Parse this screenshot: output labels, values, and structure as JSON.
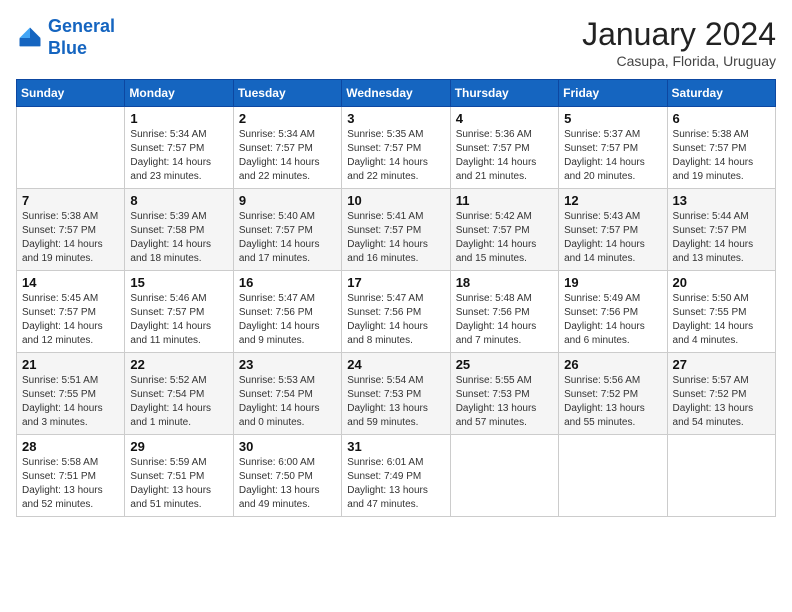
{
  "header": {
    "logo_line1": "General",
    "logo_line2": "Blue",
    "month": "January 2024",
    "location": "Casupa, Florida, Uruguay"
  },
  "days_of_week": [
    "Sunday",
    "Monday",
    "Tuesday",
    "Wednesday",
    "Thursday",
    "Friday",
    "Saturday"
  ],
  "weeks": [
    [
      {
        "day": "",
        "sunrise": "",
        "sunset": "",
        "daylight": ""
      },
      {
        "day": "1",
        "sunrise": "5:34 AM",
        "sunset": "7:57 PM",
        "daylight": "14 hours and 23 minutes."
      },
      {
        "day": "2",
        "sunrise": "5:34 AM",
        "sunset": "7:57 PM",
        "daylight": "14 hours and 22 minutes."
      },
      {
        "day": "3",
        "sunrise": "5:35 AM",
        "sunset": "7:57 PM",
        "daylight": "14 hours and 22 minutes."
      },
      {
        "day": "4",
        "sunrise": "5:36 AM",
        "sunset": "7:57 PM",
        "daylight": "14 hours and 21 minutes."
      },
      {
        "day": "5",
        "sunrise": "5:37 AM",
        "sunset": "7:57 PM",
        "daylight": "14 hours and 20 minutes."
      },
      {
        "day": "6",
        "sunrise": "5:38 AM",
        "sunset": "7:57 PM",
        "daylight": "14 hours and 19 minutes."
      }
    ],
    [
      {
        "day": "7",
        "sunrise": "5:38 AM",
        "sunset": "7:57 PM",
        "daylight": "14 hours and 19 minutes."
      },
      {
        "day": "8",
        "sunrise": "5:39 AM",
        "sunset": "7:58 PM",
        "daylight": "14 hours and 18 minutes."
      },
      {
        "day": "9",
        "sunrise": "5:40 AM",
        "sunset": "7:57 PM",
        "daylight": "14 hours and 17 minutes."
      },
      {
        "day": "10",
        "sunrise": "5:41 AM",
        "sunset": "7:57 PM",
        "daylight": "14 hours and 16 minutes."
      },
      {
        "day": "11",
        "sunrise": "5:42 AM",
        "sunset": "7:57 PM",
        "daylight": "14 hours and 15 minutes."
      },
      {
        "day": "12",
        "sunrise": "5:43 AM",
        "sunset": "7:57 PM",
        "daylight": "14 hours and 14 minutes."
      },
      {
        "day": "13",
        "sunrise": "5:44 AM",
        "sunset": "7:57 PM",
        "daylight": "14 hours and 13 minutes."
      }
    ],
    [
      {
        "day": "14",
        "sunrise": "5:45 AM",
        "sunset": "7:57 PM",
        "daylight": "14 hours and 12 minutes."
      },
      {
        "day": "15",
        "sunrise": "5:46 AM",
        "sunset": "7:57 PM",
        "daylight": "14 hours and 11 minutes."
      },
      {
        "day": "16",
        "sunrise": "5:47 AM",
        "sunset": "7:56 PM",
        "daylight": "14 hours and 9 minutes."
      },
      {
        "day": "17",
        "sunrise": "5:47 AM",
        "sunset": "7:56 PM",
        "daylight": "14 hours and 8 minutes."
      },
      {
        "day": "18",
        "sunrise": "5:48 AM",
        "sunset": "7:56 PM",
        "daylight": "14 hours and 7 minutes."
      },
      {
        "day": "19",
        "sunrise": "5:49 AM",
        "sunset": "7:56 PM",
        "daylight": "14 hours and 6 minutes."
      },
      {
        "day": "20",
        "sunrise": "5:50 AM",
        "sunset": "7:55 PM",
        "daylight": "14 hours and 4 minutes."
      }
    ],
    [
      {
        "day": "21",
        "sunrise": "5:51 AM",
        "sunset": "7:55 PM",
        "daylight": "14 hours and 3 minutes."
      },
      {
        "day": "22",
        "sunrise": "5:52 AM",
        "sunset": "7:54 PM",
        "daylight": "14 hours and 1 minute."
      },
      {
        "day": "23",
        "sunrise": "5:53 AM",
        "sunset": "7:54 PM",
        "daylight": "14 hours and 0 minutes."
      },
      {
        "day": "24",
        "sunrise": "5:54 AM",
        "sunset": "7:53 PM",
        "daylight": "13 hours and 59 minutes."
      },
      {
        "day": "25",
        "sunrise": "5:55 AM",
        "sunset": "7:53 PM",
        "daylight": "13 hours and 57 minutes."
      },
      {
        "day": "26",
        "sunrise": "5:56 AM",
        "sunset": "7:52 PM",
        "daylight": "13 hours and 55 minutes."
      },
      {
        "day": "27",
        "sunrise": "5:57 AM",
        "sunset": "7:52 PM",
        "daylight": "13 hours and 54 minutes."
      }
    ],
    [
      {
        "day": "28",
        "sunrise": "5:58 AM",
        "sunset": "7:51 PM",
        "daylight": "13 hours and 52 minutes."
      },
      {
        "day": "29",
        "sunrise": "5:59 AM",
        "sunset": "7:51 PM",
        "daylight": "13 hours and 51 minutes."
      },
      {
        "day": "30",
        "sunrise": "6:00 AM",
        "sunset": "7:50 PM",
        "daylight": "13 hours and 49 minutes."
      },
      {
        "day": "31",
        "sunrise": "6:01 AM",
        "sunset": "7:49 PM",
        "daylight": "13 hours and 47 minutes."
      },
      {
        "day": "",
        "sunrise": "",
        "sunset": "",
        "daylight": ""
      },
      {
        "day": "",
        "sunrise": "",
        "sunset": "",
        "daylight": ""
      },
      {
        "day": "",
        "sunrise": "",
        "sunset": "",
        "daylight": ""
      }
    ]
  ]
}
